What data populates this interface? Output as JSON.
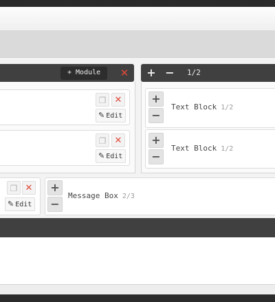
{
  "header_left": {
    "add_module_label": "+ Module",
    "delete_icon": "close-icon"
  },
  "header_right": {
    "plus": "+",
    "minus": "−",
    "size": "1/2"
  },
  "left_elements": [
    {
      "edit_label": "Edit",
      "copy_icon": "copy-icon",
      "delete_icon": "close-icon"
    },
    {
      "edit_label": "Edit",
      "copy_icon": "copy-icon",
      "delete_icon": "close-icon"
    }
  ],
  "right_elements": [
    {
      "title": "Text Block",
      "size": "1/2",
      "plus": "+",
      "minus": "−"
    },
    {
      "title": "Text Block",
      "size": "1/2",
      "plus": "+",
      "minus": "−"
    }
  ],
  "row3_left": {
    "edit_label": "Edit",
    "copy_icon": "copy-icon",
    "delete_icon": "close-icon"
  },
  "row3_right": {
    "title": "Message Box",
    "size": "2/3",
    "plus": "+",
    "minus": "−"
  },
  "colors": {
    "header_bg": "#404040",
    "delete_red": "#e04a3a"
  }
}
